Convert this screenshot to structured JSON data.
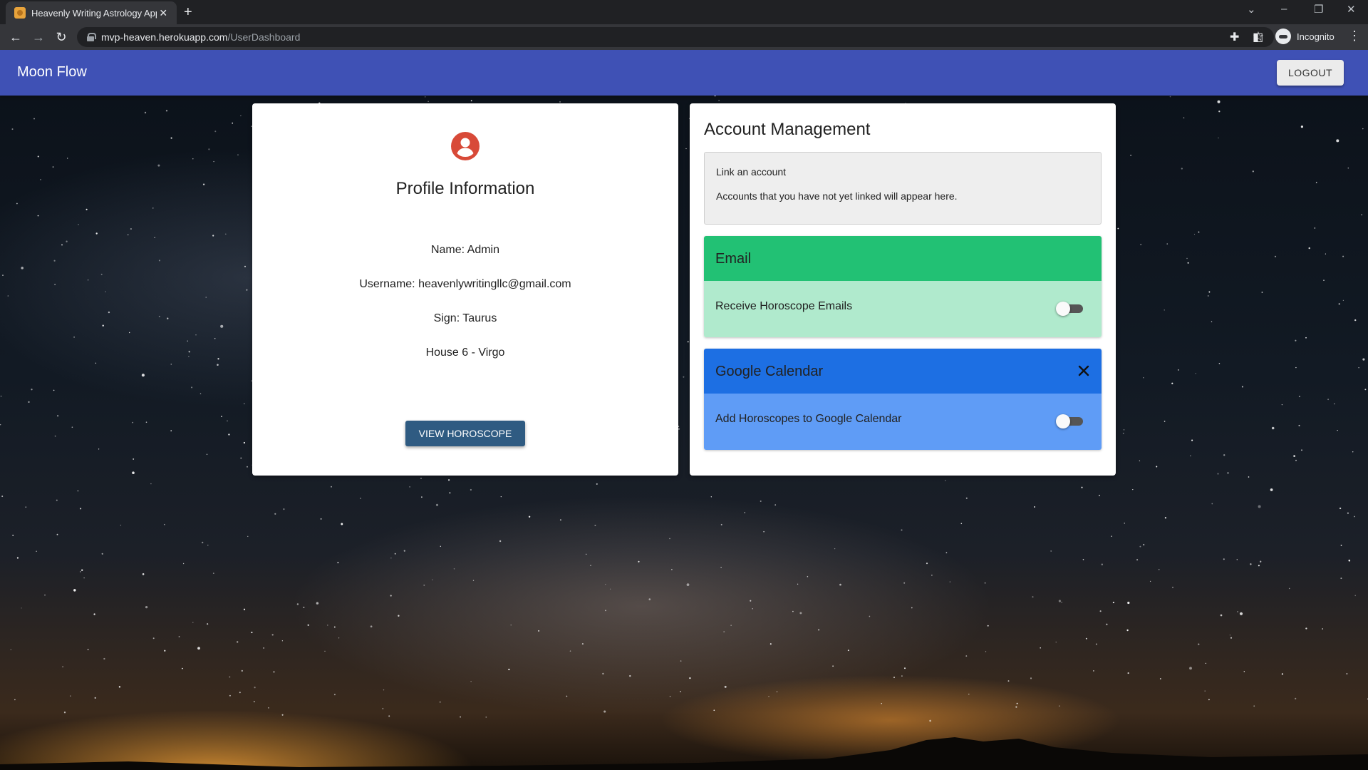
{
  "browser": {
    "tab_title": "Heavenly Writing Astrology App",
    "tab_close": "✕",
    "new_tab": "+",
    "url_host": "mvp-heaven.herokuapp.com",
    "url_path": "/UserDashboard",
    "profile_label": "Incognito"
  },
  "app": {
    "title": "Moon Flow",
    "logout_label": "LOGOUT",
    "accent_color": "#3f51b5"
  },
  "profile": {
    "heading": "Profile Information",
    "name_line": "Name: Admin",
    "username_line": "Username: heavenlywritingllc@gmail.com",
    "sign_line": "Sign: Taurus",
    "house_line": "House 6 - Virgo",
    "view_button": "VIEW HOROSCOPE",
    "avatar_icon": "account-circle-icon",
    "avatar_color": "#d84a38"
  },
  "account": {
    "heading": "Account Management",
    "link_title": "Link an account",
    "link_description": "Accounts that you have not yet linked will appear here.",
    "services": [
      {
        "title": "Email",
        "toggle_label": "Receive Horoscope Emails",
        "enabled": false,
        "header_color": "#22c174",
        "body_color": "#b0eacd"
      },
      {
        "title": "Google Calendar",
        "toggle_label": "Add Horoscopes to Google Calendar",
        "enabled": false,
        "header_color": "#1d6fe3",
        "body_color": "#5f9cf6",
        "action_icon": "close-icon"
      }
    ]
  }
}
